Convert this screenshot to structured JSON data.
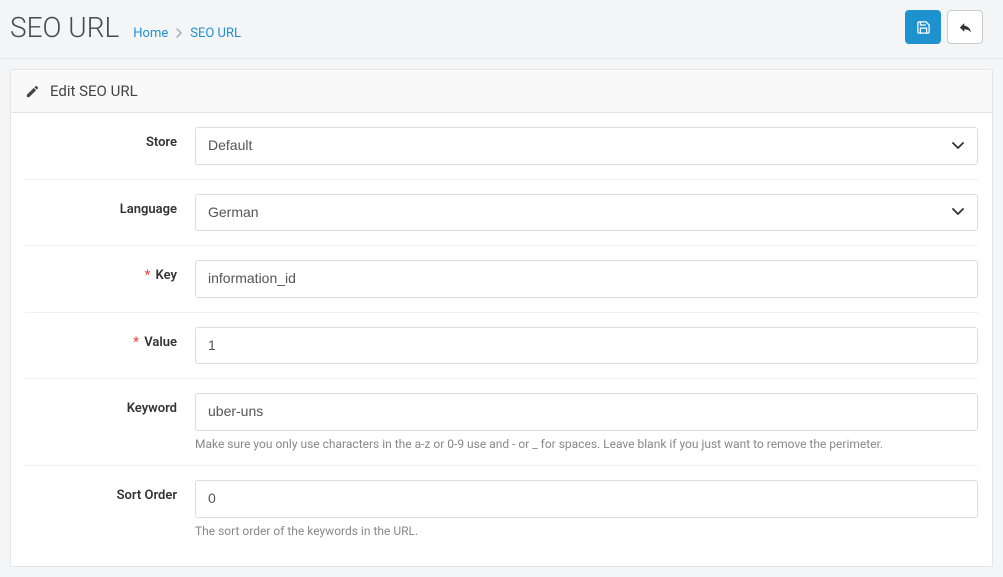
{
  "header": {
    "title": "SEO URL",
    "breadcrumb": {
      "home": "Home",
      "current": "SEO URL"
    }
  },
  "panel": {
    "title": "Edit SEO URL"
  },
  "form": {
    "store": {
      "label": "Store",
      "value": "Default"
    },
    "language": {
      "label": "Language",
      "value": "German"
    },
    "key": {
      "label": "Key",
      "value": "information_id"
    },
    "value": {
      "label": "Value",
      "value": "1"
    },
    "keyword": {
      "label": "Keyword",
      "value": "uber-uns",
      "help": "Make sure you only use characters in the a-z or 0-9 use and - or _ for spaces. Leave blank if you just want to remove the perimeter."
    },
    "sort_order": {
      "label": "Sort Order",
      "value": "0",
      "help": "The sort order of the keywords in the URL."
    }
  }
}
